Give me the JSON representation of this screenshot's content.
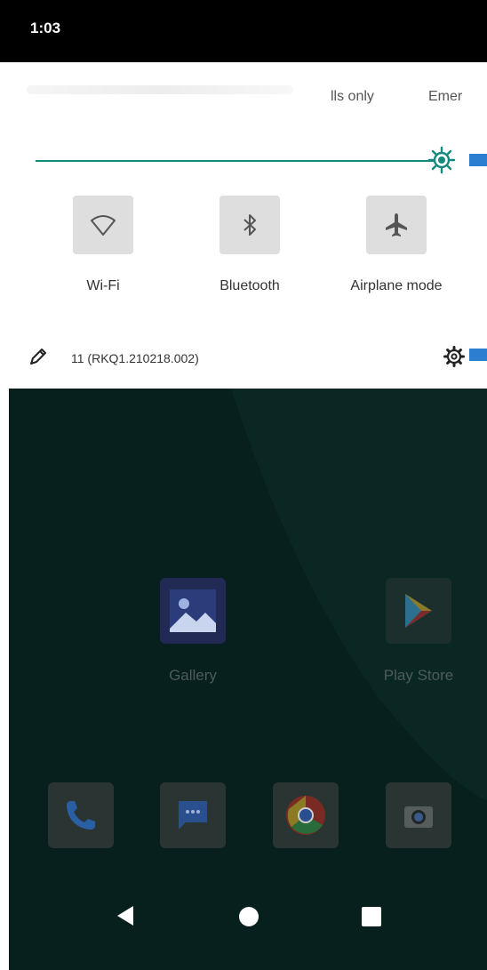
{
  "status_bar": {
    "time": "1:03"
  },
  "quick_settings": {
    "modes": {
      "calls_only": "lls only",
      "emergency": "Emer"
    },
    "brightness": {
      "level_percent": 98
    },
    "tiles": [
      {
        "label": "Wi-Fi",
        "icon": "wifi-icon"
      },
      {
        "label": "Bluetooth",
        "icon": "bluetooth-icon"
      },
      {
        "label": "Airplane mode",
        "icon": "airplane-icon"
      }
    ],
    "footer": {
      "build": "11 (RKQ1.210218.002)",
      "edit_icon": "pencil-icon",
      "settings_icon": "gear-icon"
    }
  },
  "home_screen": {
    "apps": [
      {
        "label": "Gallery",
        "icon": "gallery-icon"
      },
      {
        "label": "Play Store",
        "icon": "play-store-icon"
      }
    ],
    "dock": [
      {
        "icon": "phone-icon"
      },
      {
        "icon": "messages-icon"
      },
      {
        "icon": "chrome-icon"
      },
      {
        "icon": "camera-icon"
      }
    ]
  },
  "navigation": {
    "back": "back-icon",
    "home": "home-icon",
    "recents": "recents-icon"
  },
  "colors": {
    "accent": "#16897f",
    "scrim": "#071f1d",
    "panel": "#ffffff",
    "status_bar": "#000000",
    "edge_marker": "#2c7fd0"
  }
}
